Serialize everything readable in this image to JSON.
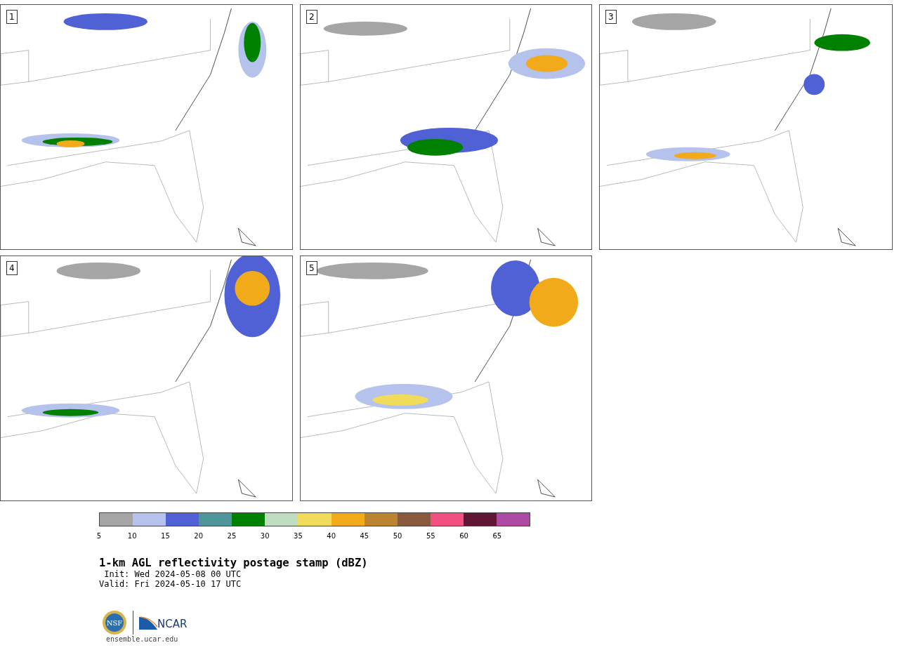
{
  "panels": [
    {
      "label": "1"
    },
    {
      "label": "2"
    },
    {
      "label": "3"
    },
    {
      "label": "4"
    },
    {
      "label": "5"
    }
  ],
  "colorbar": {
    "segments": [
      {
        "color": "#a5a5a5",
        "tick": "5"
      },
      {
        "color": "#b5c2eb",
        "tick": "10"
      },
      {
        "color": "#5060d5",
        "tick": "15"
      },
      {
        "color": "#4e969a",
        "tick": "20"
      },
      {
        "color": "#008000",
        "tick": "25"
      },
      {
        "color": "#c0ddc0",
        "tick": "30"
      },
      {
        "color": "#f0dc5a",
        "tick": "35"
      },
      {
        "color": "#f0aa1a",
        "tick": "40"
      },
      {
        "color": "#ba8430",
        "tick": "45"
      },
      {
        "color": "#8a5a3e",
        "tick": "50"
      },
      {
        "color": "#f25080",
        "tick": "55"
      },
      {
        "color": "#601634",
        "tick": "60"
      },
      {
        "color": "#ac4aa4",
        "tick": "65"
      }
    ]
  },
  "title": "1-km AGL reflectivity postage stamp (dBZ)",
  "init": " Init: Wed 2024-05-08 00 UTC",
  "valid": "Valid: Fri 2024-05-10 17 UTC",
  "logo": {
    "nsf": "NSF",
    "ncar": "NCAR"
  },
  "url": "ensemble.ucar.edu"
}
